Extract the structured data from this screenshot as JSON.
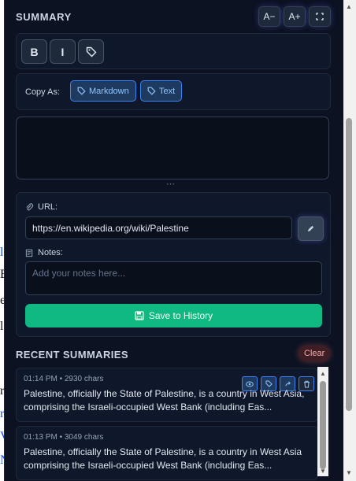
{
  "header": {
    "title": "SUMMARY",
    "font_decrease": "A−",
    "font_increase": "A+",
    "expand_icon": "expand-icon"
  },
  "format": {
    "bold": "B",
    "italic": "I",
    "tag_icon": "tag-icon"
  },
  "copy": {
    "label": "Copy As:",
    "markdown": "Markdown",
    "text": "Text"
  },
  "summary_text": "",
  "url": {
    "label": "URL:",
    "value": "https://en.wikipedia.org/wiki/Palestine",
    "edit_icon": "pencil-icon"
  },
  "notes": {
    "label": "Notes:",
    "placeholder": "Add your notes here..."
  },
  "save_button": "Save to History",
  "history": {
    "title": "RECENT SUMMARIES",
    "clear": "Clear",
    "items": [
      {
        "meta": "01:14 PM • 2930 chars",
        "text": "Palestine, officially the State of Palestine, is a country in West Asia, comprising the Israeli-occupied West Bank (including Eas..."
      },
      {
        "meta": "01:13 PM • 3049 chars",
        "text": "Palestine, officially the State of Palestine, is a country in West Asia comprising the Israeli-occupied West Bank (including Eas..."
      }
    ]
  },
  "colors": {
    "panel_bg": "#0c1222",
    "accent_green": "#10b981",
    "accent_blue": "#3b82f6",
    "danger": "#fca5a5"
  }
}
